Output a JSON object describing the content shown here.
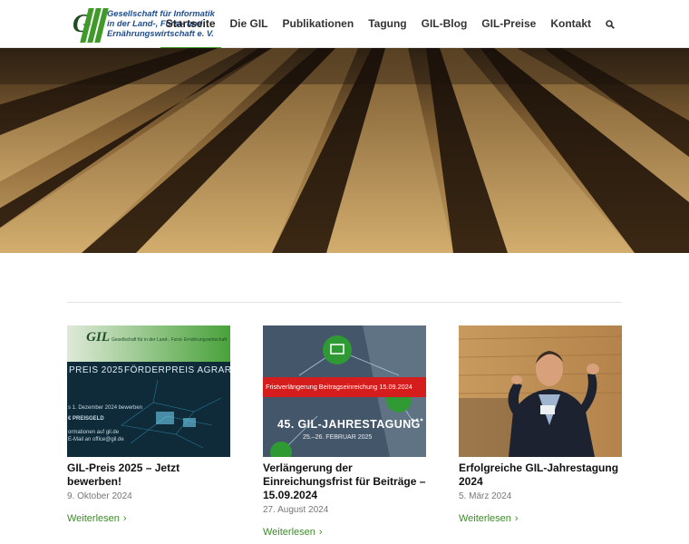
{
  "logo": {
    "line1": "Gesellschaft für Informatik",
    "line2": "in der Land-, Forst- und",
    "line3": "Ernährungswirtschaft e. V.",
    "icon": "gil-logo-icon"
  },
  "nav": {
    "items": [
      "Startseite",
      "Die GIL",
      "Publikationen",
      "Tagung",
      "GIL-Blog",
      "GIL-Preise",
      "Kontakt"
    ],
    "active_index": 0,
    "search_icon": "search-icon"
  },
  "hero": {
    "alt_icon": "field-rows-image"
  },
  "colors": {
    "accent": "#3f9a2a",
    "link": "#3f8a2a",
    "banner_red": "#d61d1d"
  },
  "posts": [
    {
      "title": "GIL-Preis 2025 – Jetzt bewerben!",
      "date": "9. Oktober 2024",
      "more": "Weiterlesen",
      "thumb": {
        "logo_text": "Gesellschaft für in der Land-, Forst- Ernährungswirtschaft",
        "title_a": "PREIS 2025",
        "title_b": "FÖRDERPREIS AGRARINFORMA",
        "line1": "s 1. Dezember 2024 bewerben",
        "line2": "€ PREISGELD",
        "line3": "ormationen auf gil.de",
        "line4": "E-Mail an office@gil.de"
      }
    },
    {
      "title": "Verlängerung der Einreichungsfrist für Beiträge – 15.09.2024",
      "date": "27. August 2024",
      "more": "Weiterlesen",
      "thumb": {
        "banner": "Fristverlängerung Beitragseinreichung 15.09.2024",
        "title": "45. GIL-JAHRESTAGUNG",
        "subtitle": "25.–26. FEBRUAR 2025"
      }
    },
    {
      "title": "Erfolgreiche GIL-Jahrestagung 2024",
      "date": "5. März 2024",
      "more": "Weiterlesen"
    }
  ]
}
